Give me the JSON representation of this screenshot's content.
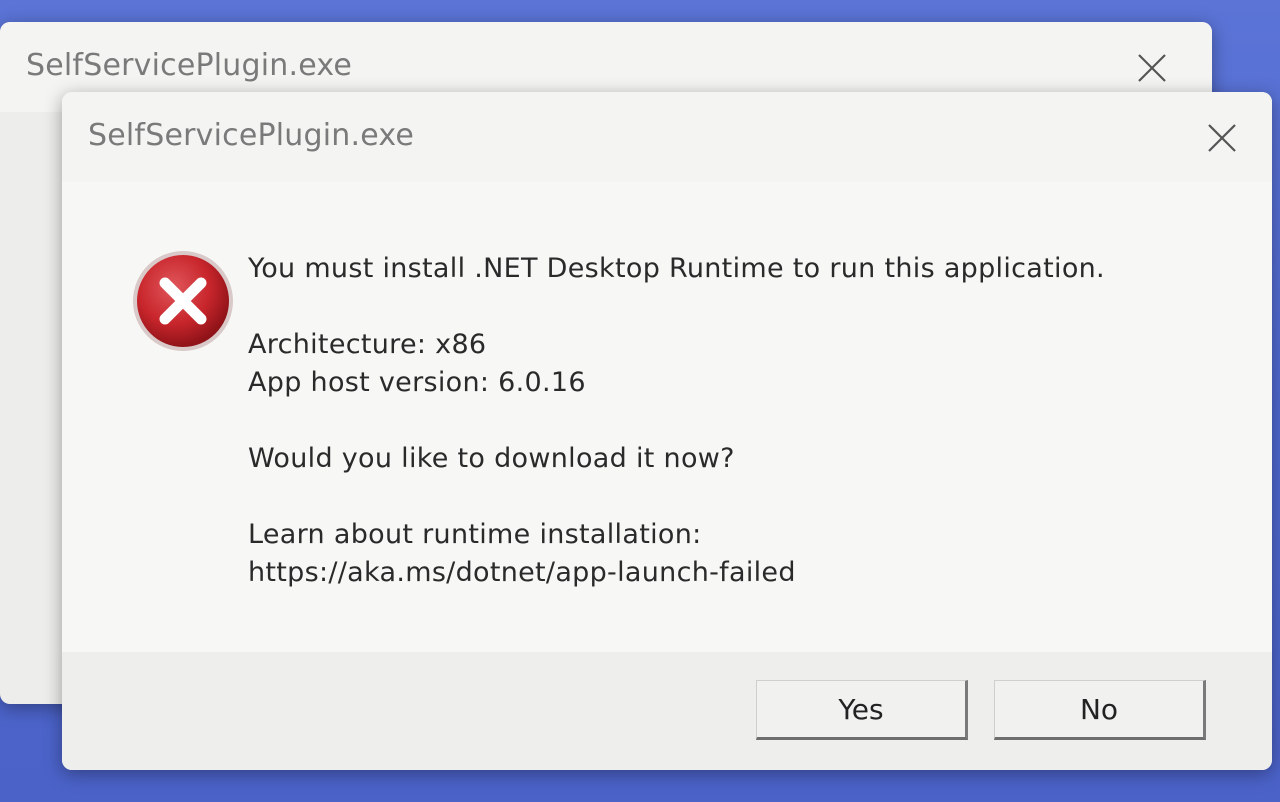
{
  "back_dialog": {
    "title": "SelfServicePlugin.exe"
  },
  "dialog": {
    "title": "SelfServicePlugin.exe",
    "icon": "error-icon",
    "message": {
      "headline": "You must install .NET Desktop Runtime to run this application.",
      "architecture": "Architecture: x86",
      "host_version": "App host version: 6.0.16",
      "question": "Would you like to download it now?",
      "learn_label": "Learn about runtime installation:",
      "learn_url": "https://aka.ms/dotnet/app-launch-failed"
    },
    "buttons": {
      "yes": "Yes",
      "no": "No"
    }
  },
  "colors": {
    "desktop_background": "#5b74d6",
    "error_red": "#c8262c",
    "dialog_background": "#f3f3f1"
  }
}
